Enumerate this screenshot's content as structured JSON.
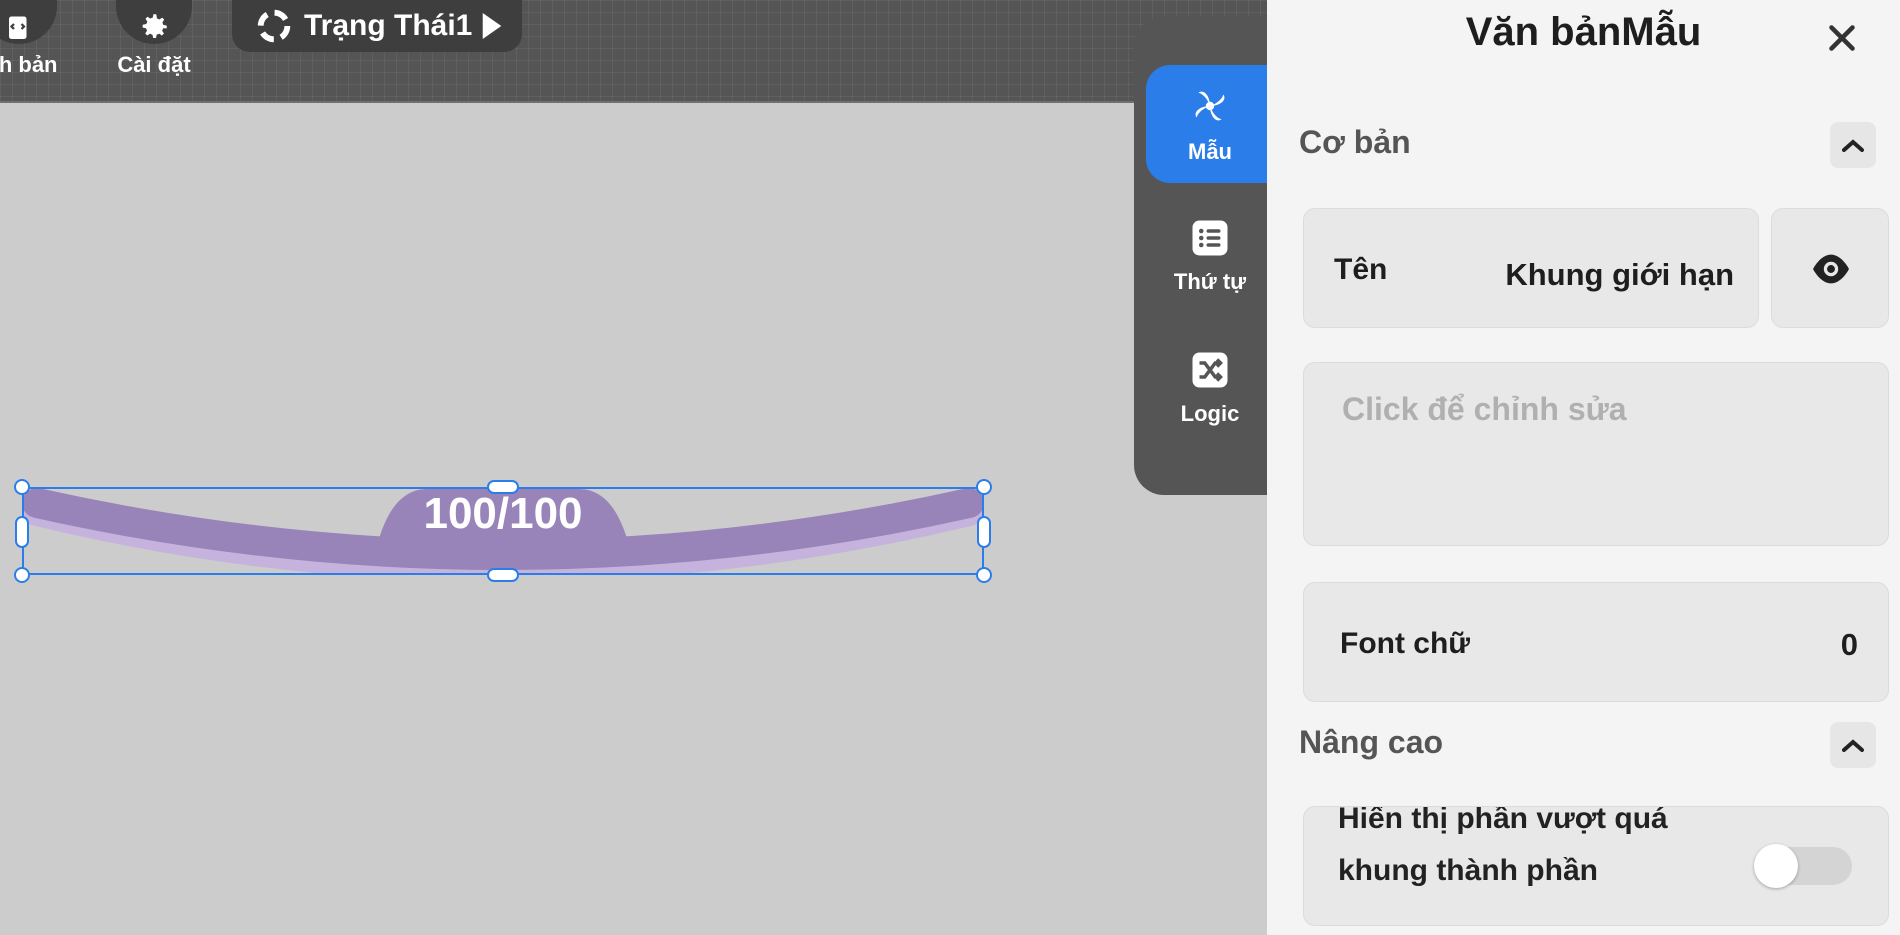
{
  "toolbar": {
    "script_label": "ịch bản",
    "settings_label": "Cài đặt",
    "state_label": "Trạng Thái1"
  },
  "sidenav": {
    "items": [
      {
        "label": "Mẫu",
        "icon": "pinwheel-icon",
        "active": true
      },
      {
        "label": "Thứ tự",
        "icon": "list-icon",
        "active": false
      },
      {
        "label": "Logic",
        "icon": "shuffle-icon",
        "active": false
      }
    ]
  },
  "canvas": {
    "element_value": "100/100",
    "element_fill_fraction": 1.0,
    "colors": {
      "bar": "#9884b8",
      "selection": "#2b7de9"
    }
  },
  "panel": {
    "title": "Văn bảnMẫu",
    "basic_section": "Cơ bản",
    "name_key": "Tên",
    "name_value": "Khung giới hạn",
    "text_placeholder": "Click để chỉnh sửa",
    "font_key": "Font chữ",
    "font_value": "0",
    "advanced_section": "Nâng cao",
    "overflow_label": "Hiển thị phần vượt quá khung thành phần",
    "overflow_toggle": false
  }
}
